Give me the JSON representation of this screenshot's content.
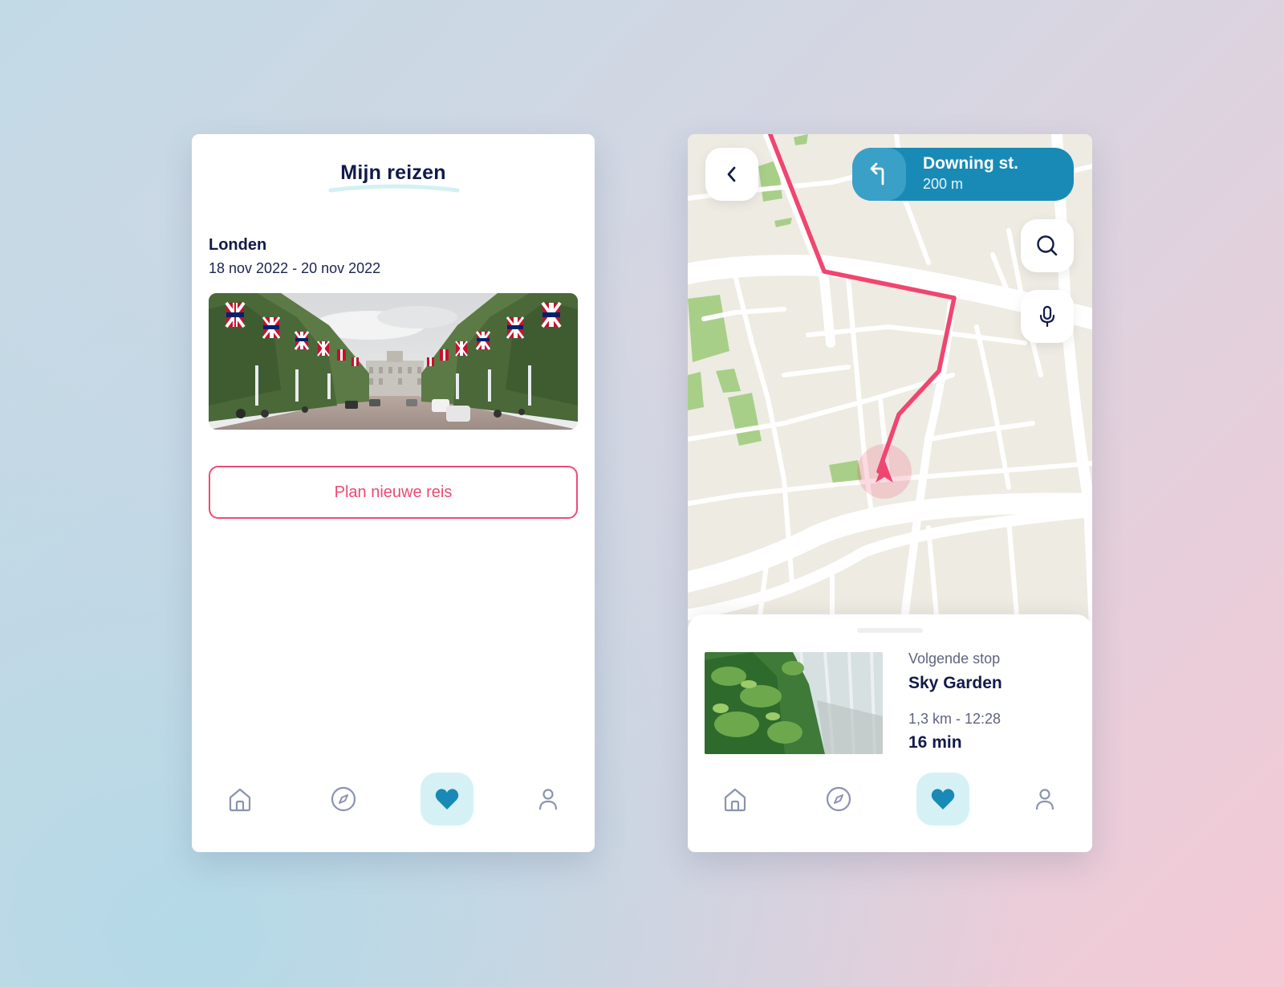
{
  "left_screen": {
    "title": "Mijn reizen",
    "trip": {
      "city": "Londen",
      "dates": "18 nov 2022 - 20 nov 2022"
    },
    "plan_button": "Plan nieuwe reis"
  },
  "right_screen": {
    "direction": {
      "street": "Downing st.",
      "distance": "200 m"
    },
    "next_stop": {
      "label": "Volgende stop",
      "name": "Sky Garden",
      "meta": "1,3 km - 12:28",
      "eta": "16 min"
    }
  },
  "nav": {
    "items": [
      "home-icon",
      "compass-icon",
      "heart-icon",
      "user-icon"
    ],
    "active": "heart-icon"
  },
  "colors": {
    "accent_pink": "#ee4b74",
    "route": "#ef4670",
    "nav_blue": "#198ab5",
    "navy_text": "#121a48",
    "active_nav_bg": "#d6f1f5"
  }
}
